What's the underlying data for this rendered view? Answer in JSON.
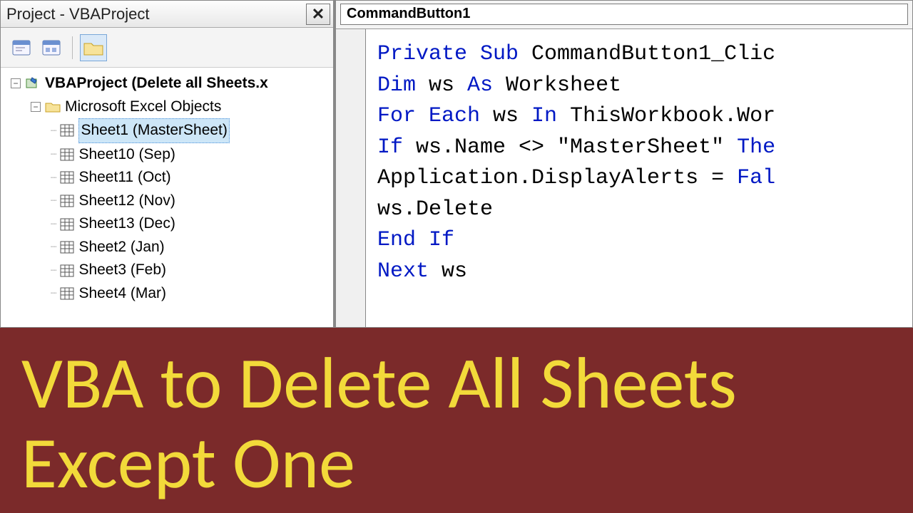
{
  "project_panel": {
    "title": "Project - VBAProject",
    "close_glyph": "✕",
    "toolbar": {
      "view_props": "view-properties",
      "view_code": "view-code",
      "folder": "toggle-folders"
    },
    "tree": {
      "root_label": "VBAProject (Delete all Sheets.x",
      "folder_label": "Microsoft Excel Objects",
      "sheets": [
        {
          "label": "Sheet1 (MasterSheet)",
          "selected": true
        },
        {
          "label": "Sheet10 (Sep)",
          "selected": false
        },
        {
          "label": "Sheet11 (Oct)",
          "selected": false
        },
        {
          "label": "Sheet12 (Nov)",
          "selected": false
        },
        {
          "label": "Sheet13 (Dec)",
          "selected": false
        },
        {
          "label": "Sheet2 (Jan)",
          "selected": false
        },
        {
          "label": "Sheet3 (Feb)",
          "selected": false
        },
        {
          "label": "Sheet4 (Mar)",
          "selected": false
        }
      ]
    }
  },
  "code_panel": {
    "dropdown_value": "CommandButton1",
    "code_lines": [
      [
        {
          "t": "Private Sub",
          "k": true
        },
        {
          "t": " CommandButton1_Clic",
          "k": false
        }
      ],
      [
        {
          "t": "Dim",
          "k": true
        },
        {
          "t": " ws ",
          "k": false
        },
        {
          "t": "As",
          "k": true
        },
        {
          "t": " Worksheet",
          "k": false
        }
      ],
      [
        {
          "t": "For Each",
          "k": true
        },
        {
          "t": " ws ",
          "k": false
        },
        {
          "t": "In",
          "k": true
        },
        {
          "t": " ThisWorkbook.Wor",
          "k": false
        }
      ],
      [
        {
          "t": "If",
          "k": true
        },
        {
          "t": " ws.Name <> \"MasterSheet\" ",
          "k": false
        },
        {
          "t": "The",
          "k": true
        }
      ],
      [
        {
          "t": "Application.DisplayAlerts = ",
          "k": false
        },
        {
          "t": "Fal",
          "k": true
        }
      ],
      [
        {
          "t": "ws.Delete",
          "k": false
        }
      ],
      [
        {
          "t": "End If",
          "k": true
        }
      ],
      [
        {
          "t": "Next",
          "k": true
        },
        {
          "t": " ws",
          "k": false
        }
      ]
    ]
  },
  "banner": {
    "line1": "VBA to Delete All Sheets",
    "line2": "Except One"
  }
}
